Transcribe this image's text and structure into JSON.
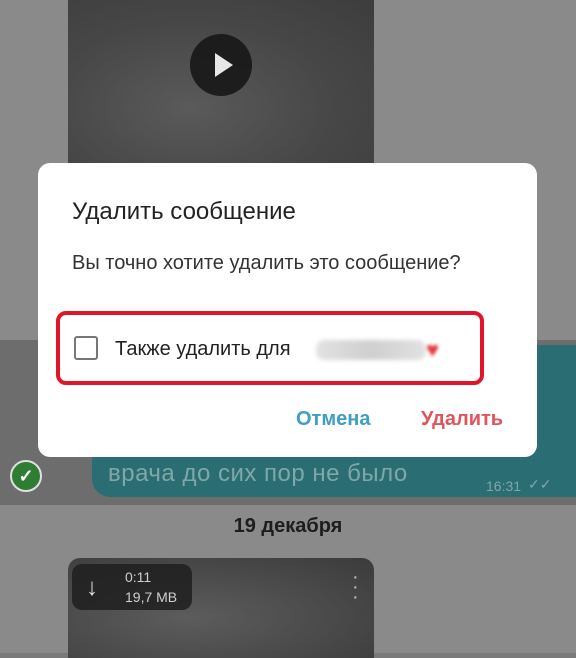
{
  "chat": {
    "bubble_text": "врача до сих пор не было",
    "bubble_time": "16:31",
    "date_separator": "19 декабря",
    "media": {
      "duration": "0:11",
      "size": "19,7 MB"
    }
  },
  "dialog": {
    "title": "Удалить сообщение",
    "message": "Вы точно хотите удалить это сообщение?",
    "checkbox_label": "Также удалить для",
    "checkbox_checked": false,
    "cancel_label": "Отмена",
    "delete_label": "Удалить"
  },
  "icons": {
    "play": "play-icon",
    "check": "check-circle-icon",
    "download": "download-icon",
    "more": "more-vertical-icon",
    "read_ticks": "double-check-icon"
  },
  "colors": {
    "accent_cancel": "#3f9fc0",
    "accent_delete": "#e0545a",
    "highlight_border": "#e1152a",
    "bubble": "#2a6e73"
  }
}
